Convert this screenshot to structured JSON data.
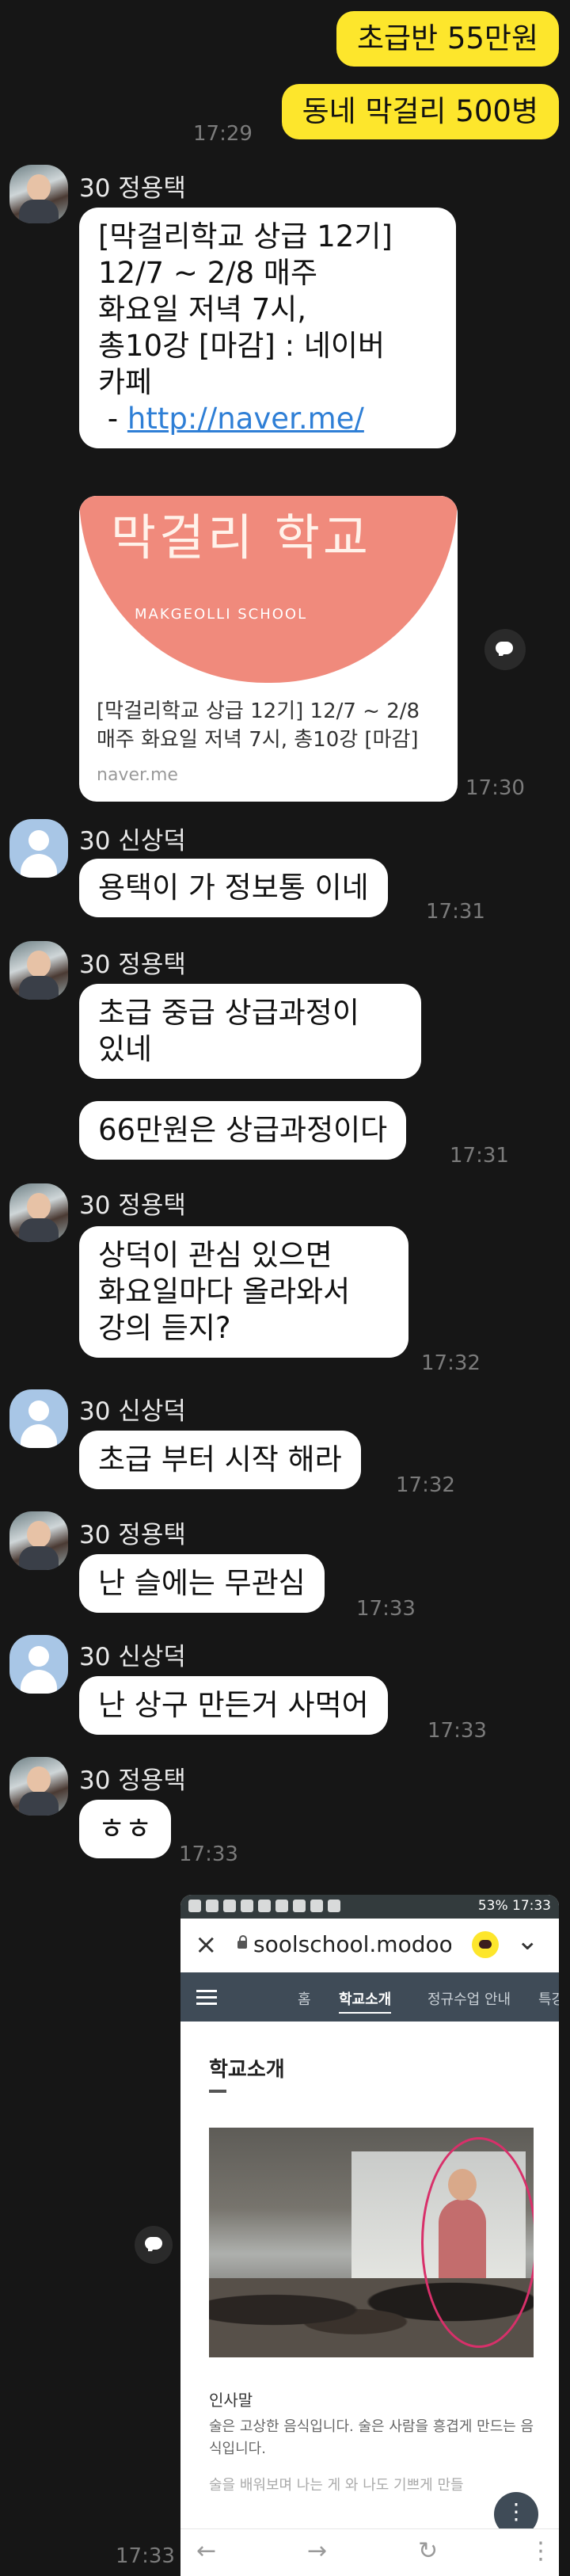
{
  "outgoing": [
    {
      "text": "초급반 55만원"
    },
    {
      "text": "동네 막걸리 500병"
    }
  ],
  "outgoing_time": "17:29",
  "messages": {
    "m1": {
      "sender": "30 정용택",
      "line1": "[막걸리학교 상급 12기]",
      "line2": "12/7 ~ 2/8 매주",
      "line3": "화요일 저녁 7시,",
      "line4": "총10강 [마감] : 네이버",
      "line5": "카페",
      "link_prefix": " - ",
      "link": "http://naver.me/"
    },
    "card": {
      "logo_ko": "막걸리 학교",
      "logo_en": "MAKGEOLLI SCHOOL",
      "title": "[막걸리학교 상급 12기] 12/7 ~ 2/8 매주 화요일 저녁 7시, 총10강 [마감]",
      "domain": "naver.me",
      "time": "17:30"
    },
    "m2": {
      "sender": "30 신상덕",
      "text": "용택이 가 정보통 이네",
      "time": "17:31"
    },
    "m3": {
      "sender": "30 정용택",
      "line1": "초급 중급 상급과정이",
      "line2": "있네",
      "text2": "66만원은 상급과정이다",
      "time": "17:31"
    },
    "m4": {
      "sender": "30 정용택",
      "line1": "상덕이 관심 있으면",
      "line2": "화요일마다 올라와서",
      "line3": "강의 듣지?",
      "time": "17:32"
    },
    "m5": {
      "sender": "30 신상덕",
      "text": "초급 부터 시작 해라",
      "time": "17:32"
    },
    "m6": {
      "sender": "30 정용택",
      "text": "난 슬에는 무관심",
      "time": "17:33"
    },
    "m7": {
      "sender": "30 신상덕",
      "text": "난 상구 만든거 사먹어",
      "time": "17:33"
    },
    "m8": {
      "sender": "30 정용택",
      "text": "ㅎㅎ",
      "time": "17:33"
    },
    "shot_time": "17:33"
  },
  "screenshot": {
    "status_right": "53% 17:33",
    "close": "×",
    "url": "soolschool.modoo.at",
    "chevron": "⌄",
    "nav": [
      "홈",
      "학교소개",
      "정규수업 안내",
      "특강"
    ],
    "page_title": "학교소개",
    "section_title": "인사말",
    "section_body": "술은 고상한 음식입니다. 술은 사람을 흥겹게 만드는 음식입니다.",
    "section_body2": "술을 배워보며 나는 게 와 나도 기쁘게 만들",
    "back": "←",
    "forward": "→",
    "reload": "↻",
    "more": "⋮"
  }
}
